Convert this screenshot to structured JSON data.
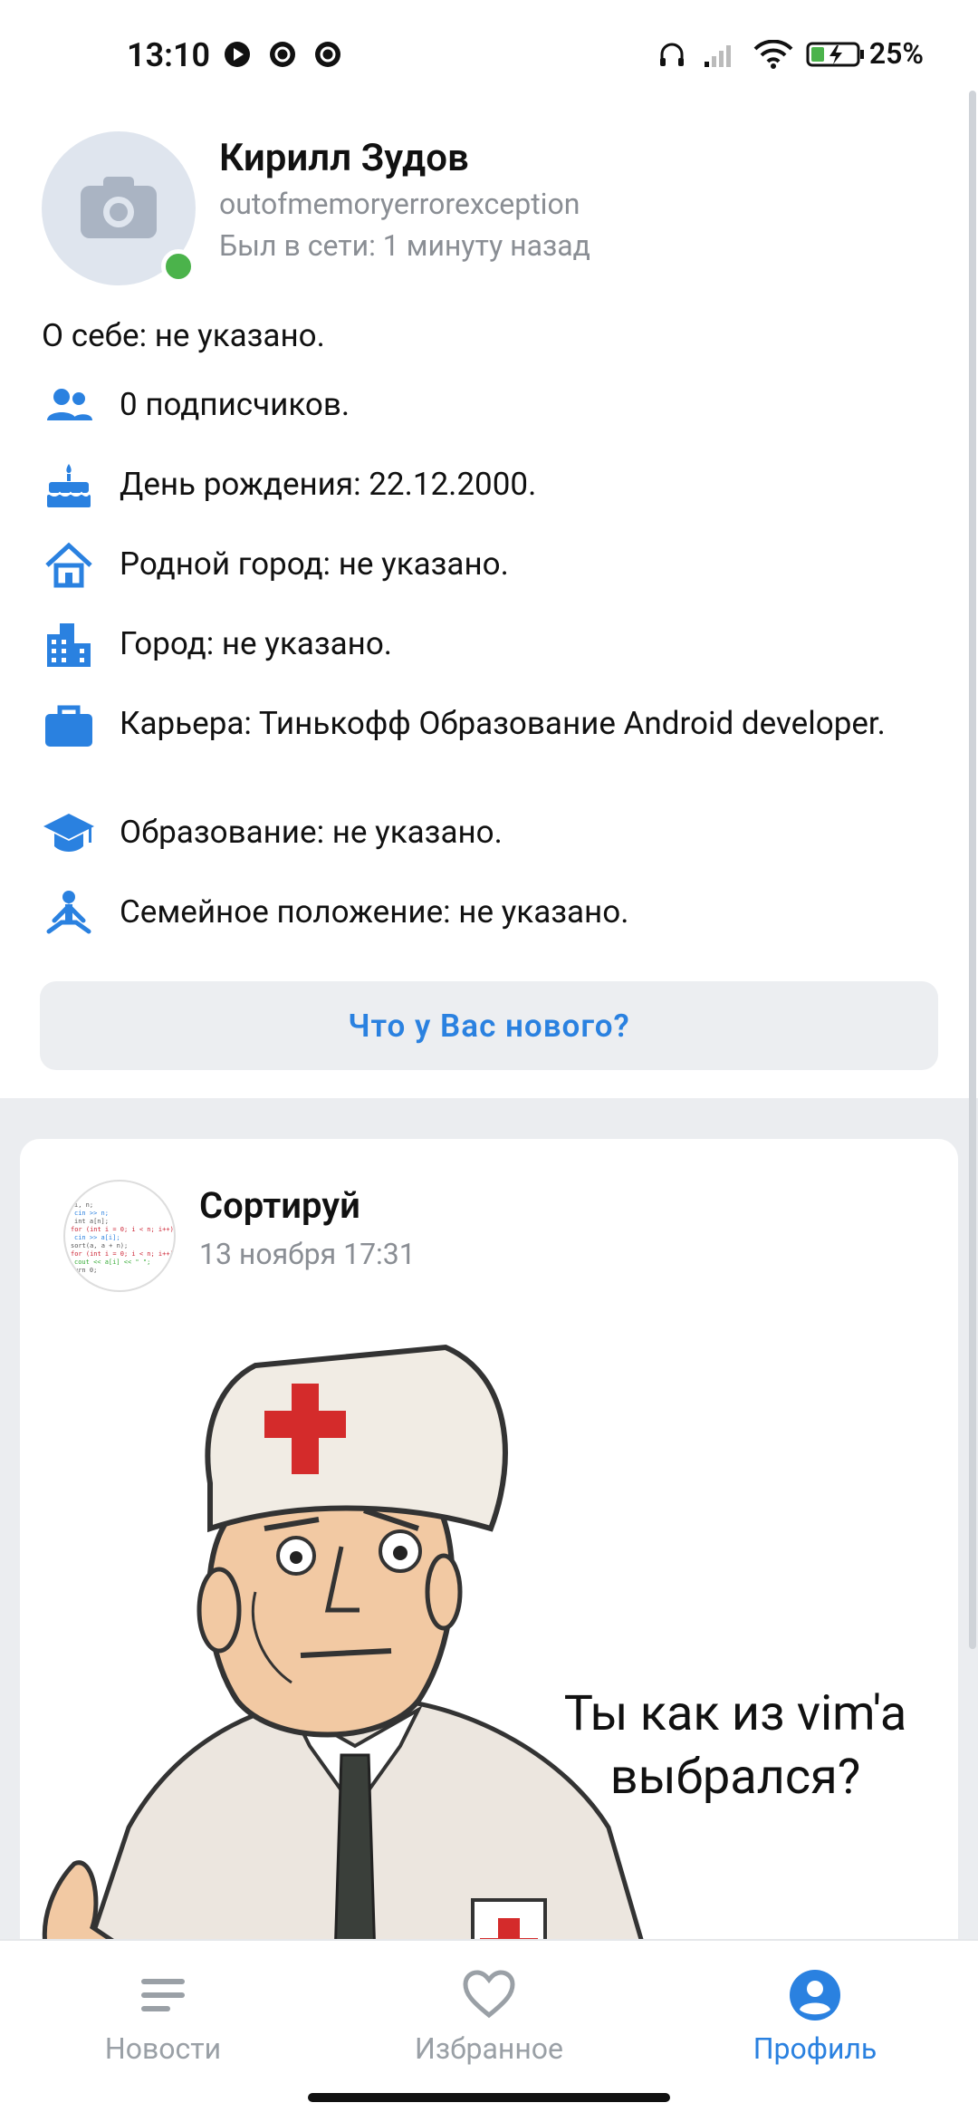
{
  "status_bar": {
    "time": "13:10",
    "battery": "25%"
  },
  "profile": {
    "name": "Кирилл Зудов",
    "username": "outofmemoryerrorexception",
    "last_seen": "Был в сети: 1 минуту назад",
    "about": "О себе: не указано.",
    "details": [
      {
        "icon": "followers-icon",
        "text": "0 подписчиков."
      },
      {
        "icon": "birthday-cake-icon",
        "text": "День рождения: 22.12.2000."
      },
      {
        "icon": "home-icon",
        "text": "Родной город: не указано."
      },
      {
        "icon": "city-icon",
        "text": "Город: не указано."
      },
      {
        "icon": "briefcase-icon",
        "text": "Карьера: Тинькофф Образование Android developer."
      },
      {
        "icon": "graduation-cap-icon",
        "text": "Образование: не указано."
      },
      {
        "icon": "family-icon",
        "text": "Семейное положение: не указано."
      }
    ],
    "new_post_button": "Что у Вас нового?"
  },
  "post": {
    "author": "Сортируй",
    "date": "13 ноября 17:31",
    "meme_caption_line1": "Ты как из vim'a",
    "meme_caption_line2": "выбрался?"
  },
  "bottom_nav": {
    "items": [
      {
        "label": "Новости",
        "icon": "news-icon",
        "active": false
      },
      {
        "label": "Избранное",
        "icon": "heart-icon",
        "active": false
      },
      {
        "label": "Профиль",
        "icon": "profile-icon",
        "active": true
      }
    ]
  },
  "colors": {
    "accent": "#2a81e0",
    "online": "#4bb34b",
    "muted": "#8a8e94",
    "feed_bg": "#ebedf0"
  }
}
